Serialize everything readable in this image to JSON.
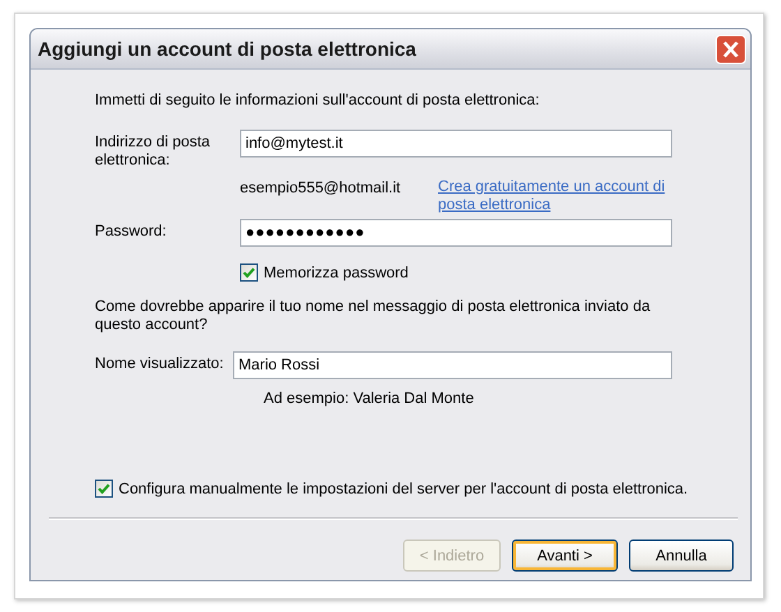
{
  "window": {
    "title": "Aggiungi un account di posta elettronica"
  },
  "intro": "Immetti di seguito le informazioni sull'account di posta elettronica:",
  "email": {
    "label": "Indirizzo di posta elettronica:",
    "value": "info@mytest.it",
    "example": "esempio555@hotmail.it",
    "link": "Crea gratuitamente un account di posta elettronica"
  },
  "password": {
    "label": "Password:",
    "value": "●●●●●●●●●●●●"
  },
  "remember": {
    "label": "Memorizza password",
    "checked": true
  },
  "question": "Come dovrebbe apparire il tuo nome nel messaggio di posta elettronica inviato da questo account?",
  "display_name": {
    "label": "Nome visualizzato:",
    "value": "Mario Rossi",
    "example": "Ad esempio: Valeria Dal Monte"
  },
  "manual": {
    "label": "Configura manualmente le impostazioni del server per l'account di posta elettronica.",
    "checked": true
  },
  "buttons": [
    {
      "label": "< Indietro",
      "disabled": true,
      "default": false
    },
    {
      "label": "Avanti >",
      "disabled": false,
      "default": true
    },
    {
      "label": "Annulla",
      "disabled": false,
      "default": false
    }
  ]
}
